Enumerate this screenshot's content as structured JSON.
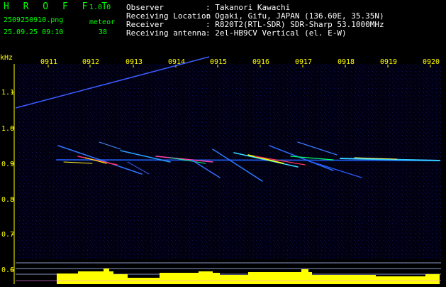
{
  "header": {
    "app_name": "H R O F F T",
    "version": "1.0.0",
    "filename": "2509250910.png",
    "datetime": "25.09.25 09:10",
    "meteor_label": "meteor",
    "meteor_count": "38",
    "info": [
      {
        "label": "Observer",
        "value": ": Takanori Kawachi"
      },
      {
        "label": "Receiving Location",
        "value": ": Ogaki, Gifu, JAPAN (136.60E, 35.35N)"
      },
      {
        "label": "Receiver",
        "value": ": R820T2(RTL-SDR) SDR-Sharp 53.1000MHz"
      },
      {
        "label": "Receiving antenna",
        "value": ": 2el-HB9CV Vertical (el. E-W)"
      }
    ]
  },
  "spectrogram": {
    "unit_label": "kHz",
    "time_ticks": [
      "0911",
      "0912",
      "0913",
      "0914",
      "0915",
      "0916",
      "0917",
      "0918",
      "0919",
      "0920"
    ],
    "freq_ticks": [
      "1.1",
      "1.0",
      "0.9",
      "0.8",
      "0.7",
      "0.6"
    ]
  },
  "colors": {
    "background": "#000000",
    "header_text": "#00ff00",
    "info_text": "#ffffff",
    "axis_text": "#ffff00",
    "activity_bar": "#ffff00"
  }
}
